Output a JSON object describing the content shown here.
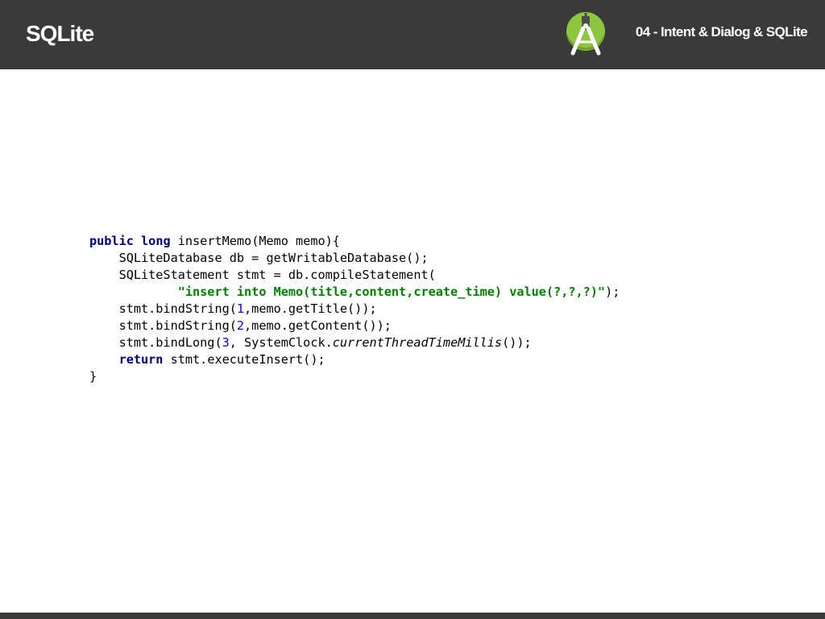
{
  "header": {
    "title": "SQLite",
    "chapter": "04 - Intent & Dialog & SQLite",
    "logo_icon": "android-studio-logo-icon"
  },
  "colors": {
    "header_bg": "#3a3a3a",
    "keyword": "#000080",
    "string": "#008000",
    "number": "#0000ff",
    "logo_green": "#8dc63f"
  },
  "code": {
    "line1_kw1": "public",
    "line1_kw2": "long",
    "line1_rest": " insertMemo(Memo memo){",
    "line2": "    SQLiteDatabase db = getWritableDatabase();",
    "line3": "    SQLiteStatement stmt = db.compileStatement(",
    "line4_indent": "            ",
    "line4_string": "\"insert into Memo(title,content,create_time) value(?,?,?)\"",
    "line4_end": ");",
    "line5_pre": "    stmt.bindString(",
    "line5_num": "1",
    "line5_post": ",memo.getTitle());",
    "line6_pre": "    stmt.bindString(",
    "line6_num": "2",
    "line6_post": ",memo.getContent());",
    "line7_pre": "    stmt.bindLong(",
    "line7_num": "3",
    "line7_mid": ", SystemClock.",
    "line7_ital": "currentThreadTimeMillis",
    "line7_post": "());",
    "line8_indent": "    ",
    "line8_kw": "return",
    "line8_rest": " stmt.executeInsert();",
    "line9": "}"
  }
}
